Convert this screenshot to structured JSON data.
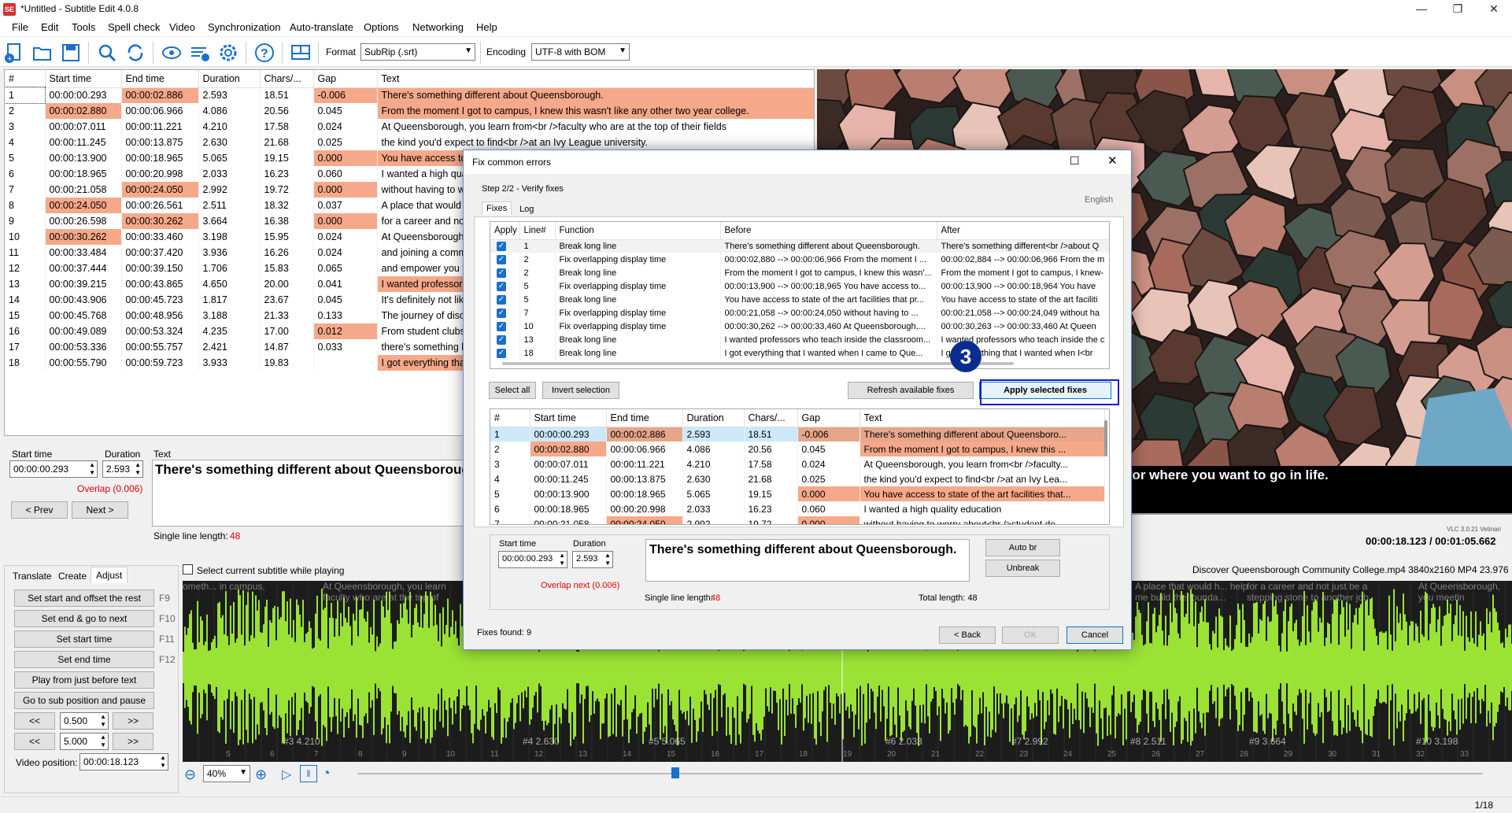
{
  "window": {
    "title": "*Untitled - Subtitle Edit 4.0.8",
    "app_icon": "SE",
    "controls": [
      "—",
      "❐",
      "✕"
    ]
  },
  "menu": [
    "File",
    "Edit",
    "Tools",
    "Spell check",
    "Video",
    "Synchronization",
    "Auto-translate",
    "Options",
    "Networking",
    "Help"
  ],
  "toolbar": {
    "icons": [
      "new-icon",
      "open-icon",
      "save-icon",
      "find-icon",
      "replace-icon",
      "visual-sync-icon",
      "spell-check-icon",
      "settings-icon",
      "help-icon",
      "layout-icon"
    ],
    "format_label": "Format",
    "format_value": "SubRip (.srt)",
    "encoding_label": "Encoding",
    "encoding_value": "UTF-8 with BOM"
  },
  "main_grid": {
    "headers": [
      "#",
      "Start time",
      "End time",
      "Duration",
      "Chars/...",
      "Gap",
      "Text"
    ],
    "rows": [
      {
        "n": "1",
        "start": "00:00:00.293",
        "end": "00:00:02.886",
        "dur": "2.593",
        "chars": "18.51",
        "gap": "-0.006",
        "text": "There's something different about Queensborough.",
        "hl_end": true,
        "hl_gap": true,
        "hl_text": true,
        "hl_start": false
      },
      {
        "n": "2",
        "start": "00:00:02.880",
        "end": "00:00:06.966",
        "dur": "4.086",
        "chars": "20.56",
        "gap": "0.045",
        "text": "From the moment I got to campus, I knew this wasn't like any other two year college.",
        "hl_start": true,
        "hl_text": true
      },
      {
        "n": "3",
        "start": "00:00:07.011",
        "end": "00:00:11.221",
        "dur": "4.210",
        "chars": "17.58",
        "gap": "0.024",
        "text": "At Queensborough, you learn from<br />faculty who are at the top of their fields"
      },
      {
        "n": "4",
        "start": "00:00:11.245",
        "end": "00:00:13.875",
        "dur": "2.630",
        "chars": "21.68",
        "gap": "0.025",
        "text": "the kind you'd expect to find<br />at an Ivy League university."
      },
      {
        "n": "5",
        "start": "00:00:13.900",
        "end": "00:00:18.965",
        "dur": "5.065",
        "chars": "19.15",
        "gap": "0.000",
        "text": "You have access to state of the art facilities that prepare you for where you want to go in life.",
        "hl_gap": true,
        "hl_text": true
      },
      {
        "n": "6",
        "start": "00:00:18.965",
        "end": "00:00:20.998",
        "dur": "2.033",
        "chars": "16.23",
        "gap": "0.060",
        "text": "I wanted a high quality education"
      },
      {
        "n": "7",
        "start": "00:00:21.058",
        "end": "00:00:24.050",
        "dur": "2.992",
        "chars": "19.72",
        "gap": "0.000",
        "text": "without having to worry about<br />student debt.",
        "hl_end": true,
        "hl_gap": true
      },
      {
        "n": "8",
        "start": "00:00:24.050",
        "end": "00:00:26.561",
        "dur": "2.511",
        "chars": "18.32",
        "gap": "0.037",
        "text": "A place that would help me build the foundation",
        "hl_start": true
      },
      {
        "n": "9",
        "start": "00:00:26.598",
        "end": "00:00:30.262",
        "dur": "3.664",
        "chars": "16.38",
        "gap": "0.000",
        "text": "for a career and not just be a stepping stone to another job.",
        "hl_end": true,
        "hl_gap": true
      },
      {
        "n": "10",
        "start": "00:00:30.262",
        "end": "00:00:33.460",
        "dur": "3.198",
        "chars": "15.95",
        "gap": "0.024",
        "text": "At Queensborough, you meet people from all walks of life",
        "hl_start": true
      },
      {
        "n": "11",
        "start": "00:00:33.484",
        "end": "00:00:37.420",
        "dur": "3.936",
        "chars": "16.26",
        "gap": "0.024",
        "text": "and joining a community that supports you"
      },
      {
        "n": "12",
        "start": "00:00:37.444",
        "end": "00:00:39.150",
        "dur": "1.706",
        "chars": "15.83",
        "gap": "0.065",
        "text": "and empower you to achieve"
      },
      {
        "n": "13",
        "start": "00:00:39.215",
        "end": "00:00:43.865",
        "dur": "4.650",
        "chars": "20.00",
        "gap": "0.041",
        "text": "I wanted professors who teach inside the classroom and beyond.",
        "hl_text": true
      },
      {
        "n": "14",
        "start": "00:00:43.906",
        "end": "00:00:45.723",
        "dur": "1.817",
        "chars": "23.67",
        "gap": "0.045",
        "text": "It's definitely not like high school."
      },
      {
        "n": "15",
        "start": "00:00:45.768",
        "end": "00:00:48.956",
        "dur": "3.188",
        "chars": "21.33",
        "gap": "0.133",
        "text": "The journey of discovery starts here."
      },
      {
        "n": "16",
        "start": "00:00:49.089",
        "end": "00:00:53.324",
        "dur": "4.235",
        "chars": "17.00",
        "gap": "0.012",
        "text": "From student clubs to study abroad",
        "hl_gap": true
      },
      {
        "n": "17",
        "start": "00:00:53.336",
        "end": "00:00:55.757",
        "dur": "2.421",
        "chars": "14.87",
        "gap": "0.033",
        "text": "there's something here for you."
      },
      {
        "n": "18",
        "start": "00:00:55.790",
        "end": "00:00:59.723",
        "dur": "3.933",
        "chars": "19.83",
        "gap": "",
        "text": "I got everything that I wanted when I came to Queensborough.",
        "hl_text": true
      }
    ]
  },
  "edit_panel": {
    "start_time_label": "Start time",
    "start_time_value": "00:00:00.293",
    "duration_label": "Duration",
    "duration_value": "2.593",
    "text_label": "Text",
    "text_value": "There's something different about Queensborough.",
    "overlap": "Overlap (0.006)",
    "prev": "< Prev",
    "next": "Next >",
    "single_line_label": "Single line length:",
    "single_line_value": "48"
  },
  "video": {
    "subtitle": "es that prepare you for where you want to go in life.",
    "vlc": "VLC 3.0.21 Vetinari",
    "time": "00:00:18.123 / 00:01:05.662",
    "file_info": "Discover Queensborough Community College.mp4 3840x2160 MP4 23.976"
  },
  "adjust_panel": {
    "tabs": [
      "Translate",
      "Create",
      "Adjust"
    ],
    "select_while_playing": "Select current subtitle while playing",
    "buttons": [
      {
        "label": "Set start and offset the rest",
        "key": "F9"
      },
      {
        "label": "Set end & go to next",
        "key": "F10"
      },
      {
        "label": "Set start time",
        "key": "F11"
      },
      {
        "label": "Set end time",
        "key": "F12"
      },
      {
        "label": "Play from just before text",
        "key": ""
      },
      {
        "label": "Go to sub position and pause",
        "key": ""
      }
    ],
    "step1": "0.500",
    "step2": "5.000",
    "back": "<<",
    "fwd": ">>",
    "video_position_label": "Video position:",
    "video_position_value": "00:00:18.123",
    "zoom": "40%"
  },
  "waveform": {
    "labels": [
      "#3  4.210",
      "#4  2.630",
      "#5  5.065",
      "#6  2.033",
      "#7  2.992",
      "#8  2.511",
      "#9  3.664",
      "#10  3.198"
    ],
    "ticks": [
      "5",
      "6",
      "7",
      "8",
      "9",
      "10",
      "11",
      "12",
      "13",
      "14",
      "15",
      "16",
      "17",
      "18",
      "19",
      "20",
      "21",
      "22",
      "23",
      "24",
      "25",
      "26",
      "27",
      "28",
      "29",
      "30",
      "31",
      "32",
      "33"
    ],
    "texts": [
      "ometh... in campus,",
      "At Queensborough, you learn faculty who are at the top of",
      "A place that would h... help me build the founda...",
      "for a career and not just be a stepping stone to another job.",
      "At Queensborough, you meetin"
    ]
  },
  "status": {
    "count": "1/18"
  },
  "dialog": {
    "title": "Fix common errors",
    "step": "Step 2/2 - Verify fixes",
    "language": "English",
    "tabs": [
      "Fixes",
      "Log"
    ],
    "fix_headers": [
      "Apply",
      "Line#",
      "Function",
      "Before",
      "After"
    ],
    "fixes": [
      {
        "line": "1",
        "func": "Break long line",
        "before": "There's something different about Queensborough.",
        "after": "There's something different<br />about Q"
      },
      {
        "line": "2",
        "func": "Fix overlapping display time",
        "before": "00:00:02,880 --> 00:00:06,966 From the moment I ...",
        "after": "00:00:02,884 --> 00:00:06,966 From the m"
      },
      {
        "line": "2",
        "func": "Break long line",
        "before": "From the moment I got to campus, I knew this wasn'...",
        "after": "From the moment I got to campus, I knew-"
      },
      {
        "line": "5",
        "func": "Fix overlapping display time",
        "before": "00:00:13,900 --> 00:00:18,965 You have access to...",
        "after": "00:00:13,900 --> 00:00:18,964 You have"
      },
      {
        "line": "5",
        "func": "Break long line",
        "before": "You have access to state of the art facilities that pr...",
        "after": "You have access to state of the art faciliti"
      },
      {
        "line": "7",
        "func": "Fix overlapping display time",
        "before": "00:00:21,058 --> 00:00:24,050 without having to ...",
        "after": "00:00:21,058 --> 00:00:24,049 without ha"
      },
      {
        "line": "10",
        "func": "Fix overlapping display time",
        "before": "00:00:30,262 --> 00:00:33,460 At Queensborough,...",
        "after": "00:00:30,263 --> 00:00:33,460 At Queen"
      },
      {
        "line": "13",
        "func": "Break long line",
        "before": "I wanted professors who teach inside the classroom...",
        "after": "I wanted professors who teach inside the c"
      },
      {
        "line": "18",
        "func": "Break long line",
        "before": "I got everything that I wanted when I came to Que...",
        "after": "I got everything that I wanted when I<br"
      }
    ],
    "select_all": "Select all",
    "invert": "Invert selection",
    "refresh": "Refresh available fixes",
    "apply": "Apply selected fixes",
    "callout": "3",
    "preview_headers": [
      "#",
      "Start time",
      "End time",
      "Duration",
      "Chars/...",
      "Gap",
      "Text"
    ],
    "preview_rows": [
      {
        "n": "1",
        "start": "00:00:00.293",
        "end": "00:00:02.886",
        "dur": "2.593",
        "chars": "18.51",
        "gap": "-0.006",
        "text": "There's something different about Queensboro..."
      },
      {
        "n": "2",
        "start": "00:00:02.880",
        "end": "00:00:06.966",
        "dur": "4.086",
        "chars": "20.56",
        "gap": "0.045",
        "text": "From the moment I got to campus, I knew this ..."
      },
      {
        "n": "3",
        "start": "00:00:07.011",
        "end": "00:00:11.221",
        "dur": "4.210",
        "chars": "17.58",
        "gap": "0.024",
        "text": "At Queensborough, you learn from<br />faculty..."
      },
      {
        "n": "4",
        "start": "00:00:11.245",
        "end": "00:00:13.875",
        "dur": "2.630",
        "chars": "21.68",
        "gap": "0.025",
        "text": "the kind you'd expect to find<br />at an Ivy Lea..."
      },
      {
        "n": "5",
        "start": "00:00:13.900",
        "end": "00:00:18.965",
        "dur": "5.065",
        "chars": "19.15",
        "gap": "0.000",
        "text": "You have access to state of the art facilities that..."
      },
      {
        "n": "6",
        "start": "00:00:18.965",
        "end": "00:00:20.998",
        "dur": "2.033",
        "chars": "16.23",
        "gap": "0.060",
        "text": "I wanted a high quality education"
      },
      {
        "n": "7",
        "start": "00:00:21.058",
        "end": "00:00:24.050",
        "dur": "2.992",
        "chars": "19.72",
        "gap": "0.000",
        "text": "without having to worry about<br />student de..."
      }
    ],
    "start_time_label": "Start time",
    "start_time_value": "00:00:00.293",
    "duration_label": "Duration",
    "duration_value": "2.593",
    "preview_text": "There's something different about Queensborough.",
    "overlap_next": "Overlap next (0.006)",
    "auto_br": "Auto br",
    "unbreak": "Unbreak",
    "single_line_label": "Single line length:",
    "single_line_value": "48",
    "total_length": "Total length: 48",
    "fixes_found": "Fixes found: 9",
    "back": "< Back",
    "ok": "OK",
    "cancel": "Cancel"
  }
}
